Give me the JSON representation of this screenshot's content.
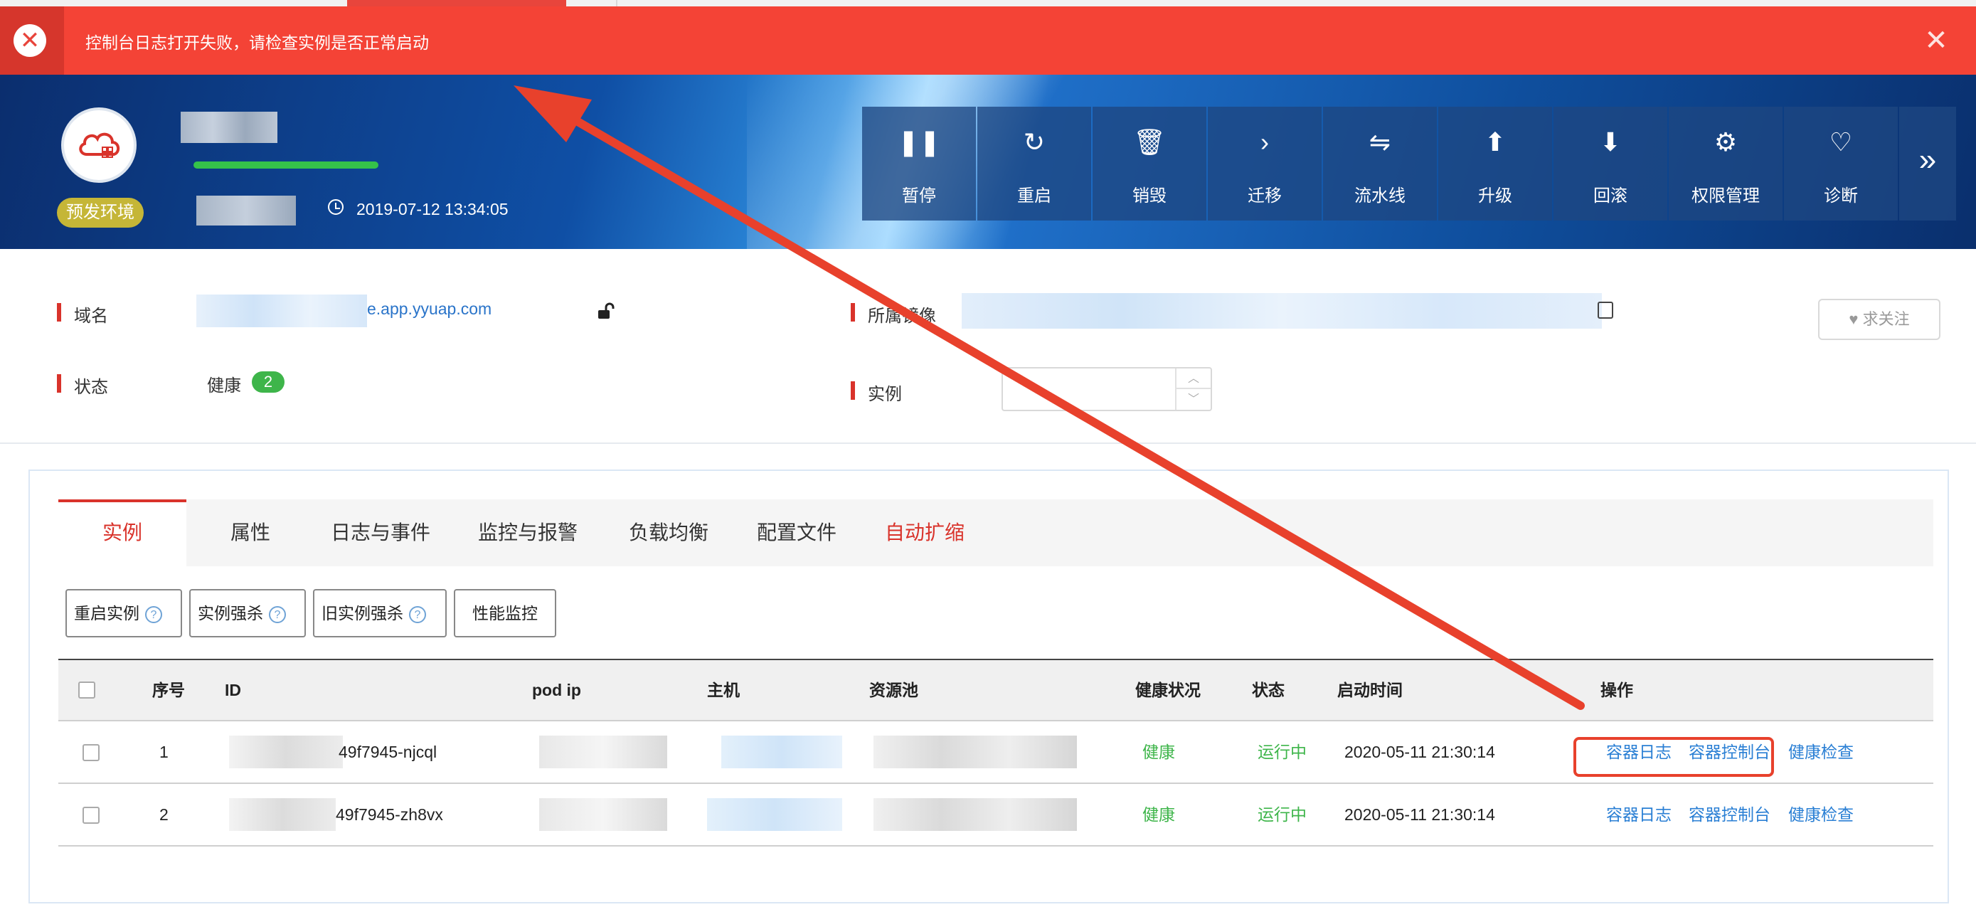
{
  "banner": {
    "message": "控制台日志打开失败，请检查实例是否正常启动"
  },
  "header": {
    "env_badge": "预发环境",
    "timestamp": "2019-07-12 13:34:05",
    "toolbar": [
      {
        "label": "暂停",
        "icon": "pause-icon",
        "glyph": "❚❚"
      },
      {
        "label": "重启",
        "icon": "restart-icon",
        "glyph": "↻"
      },
      {
        "label": "销毁",
        "icon": "trash-icon",
        "glyph": "🗑"
      },
      {
        "label": "迁移",
        "icon": "chevron-right-icon",
        "glyph": "›"
      },
      {
        "label": "流水线",
        "icon": "pipeline-icon",
        "glyph": "⇋"
      },
      {
        "label": "升级",
        "icon": "upgrade-icon",
        "glyph": "⬆"
      },
      {
        "label": "回滚",
        "icon": "rollback-icon",
        "glyph": "⬇"
      },
      {
        "label": "权限管理",
        "icon": "user-gear-icon",
        "glyph": "⚙"
      },
      {
        "label": "诊断",
        "icon": "heartbeat-icon",
        "glyph": "♡"
      }
    ],
    "more_glyph": "»"
  },
  "info": {
    "domain_label": "域名",
    "domain_value": "e.app.yyuap.com",
    "image_label": "所属镜像",
    "status_label": "状态",
    "status_value": "健康",
    "status_count": "2",
    "instance_label": "实例",
    "follow_label": "求关注",
    "stepper_up": "︿",
    "stepper_down": "﹀"
  },
  "tabs": [
    "实例",
    "属性",
    "日志与事件",
    "监控与报警",
    "负载均衡",
    "配置文件",
    "自动扩缩"
  ],
  "actions": [
    "重启实例",
    "实例强杀",
    "旧实例强杀",
    "性能监控"
  ],
  "help_glyph": "?",
  "table": {
    "headers": [
      "序号",
      "ID",
      "pod ip",
      "主机",
      "资源池",
      "健康状况",
      "状态",
      "启动时间",
      "操作"
    ],
    "rows": [
      {
        "index": "1",
        "id_suffix": "49f7945-njcql",
        "health": "健康",
        "state": "运行中",
        "start": "2020-05-11 21:30:14",
        "ops": [
          "容器日志",
          "容器控制台",
          "健康检查"
        ]
      },
      {
        "index": "2",
        "id_suffix": "49f7945-zh8vx",
        "health": "健康",
        "state": "运行中",
        "start": "2020-05-11 21:30:14",
        "ops": [
          "容器日志",
          "容器控制台",
          "健康检查"
        ]
      }
    ]
  },
  "colors": {
    "banner": "#f44336",
    "accent_red": "#d9332b",
    "link_blue": "#2a7fd4",
    "ok_green": "#3eb54a",
    "annotation": "#e8412c"
  }
}
